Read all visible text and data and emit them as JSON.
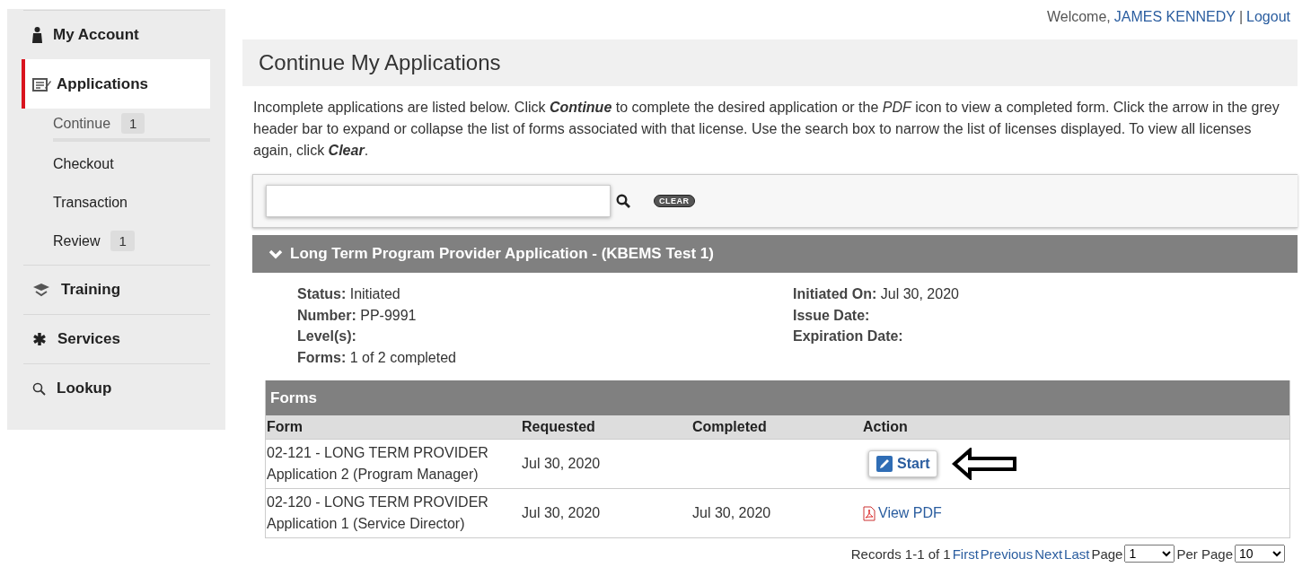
{
  "header": {
    "welcome": "Welcome,",
    "user": "JAMES KENNEDY",
    "separator": "|",
    "logout": "Logout"
  },
  "sidebar": {
    "items": [
      {
        "label": "My Account",
        "selected": false
      },
      {
        "label": "Applications",
        "selected": true,
        "children": [
          {
            "label": "Continue",
            "badge": "1",
            "selected": true
          },
          {
            "label": "Checkout",
            "selected": false
          },
          {
            "label": "Transaction",
            "selected": false
          },
          {
            "label": "Review",
            "badge": "1",
            "selected": false
          }
        ]
      },
      {
        "label": "Training",
        "selected": false
      },
      {
        "label": "Services",
        "selected": false
      },
      {
        "label": "Lookup",
        "selected": false
      }
    ]
  },
  "page_title": "Continue My Applications",
  "intro": "Incomplete applications are listed below. Click **Continue** to complete the desired application or the *PDF* icon to view a completed form. Click the arrow in the grey header bar to expand or collapse the list of forms associated with that license. Use the search box to narrow the list of licenses displayed. To view all licenses again, click **Clear**.",
  "search": {
    "clear_label": "CLEAR"
  },
  "license": {
    "title": "Long Term Program Provider Application - (KBEMS Test 1)",
    "expanded": true,
    "details_left": [
      "**Status:** Initiated",
      "**Number:** PP-9991",
      "**Level(s):**",
      "**Forms:** 1 of 2 completed"
    ],
    "details_right": [
      "**Initiated On:** Jul 30, 2020",
      "**Issue Date:**",
      "**Expiration Date:**"
    ],
    "forms": {
      "title": "Forms",
      "columns": [
        "Form",
        "Requested",
        "Completed",
        "Action"
      ],
      "rows": [
        {
          "form": "02-121 - LONG TERM PROVIDER Application 2 (Program Manager)",
          "requested": "Jul 30, 2020",
          "action": {
            "kind": "button",
            "label": "Start"
          },
          "pointer_arrow": true
        },
        {
          "form": "02-120 - LONG TERM PROVIDER Application 1 (Service Director)",
          "requested": "Jul 30, 2020",
          "completed": "Jul 30, 2020",
          "action": {
            "kind": "pdf",
            "label": "View PDF"
          },
          "pointer_arrow": false
        }
      ]
    }
  },
  "pager": {
    "records": "Records 1-1 of 1",
    "links": [
      "First",
      "Previous",
      "Next",
      "Last"
    ],
    "page_label": "Page",
    "page": "1",
    "per_page_label": "Per Page",
    "per_page": "10"
  }
}
